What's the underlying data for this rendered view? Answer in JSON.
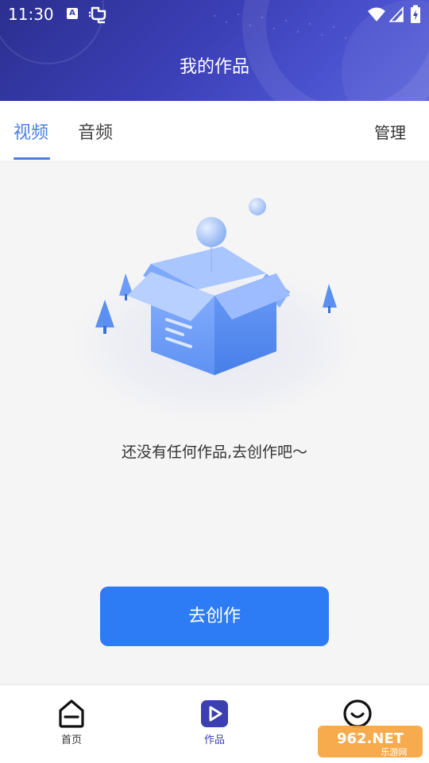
{
  "status_bar": {
    "time": "11:30",
    "a_badge": "A"
  },
  "header": {
    "title": "我的作品"
  },
  "tabs": {
    "items": [
      {
        "label": "视频",
        "active": true
      },
      {
        "label": "音频",
        "active": false
      }
    ],
    "manage_label": "管理"
  },
  "empty_state": {
    "message": "还没有任何作品,去创作吧～"
  },
  "actions": {
    "create_label": "去创作"
  },
  "bottom_nav": {
    "items": [
      {
        "label": "首页",
        "icon": "home-icon",
        "active": false
      },
      {
        "label": "作品",
        "icon": "play-icon",
        "active": true
      },
      {
        "label": "",
        "icon": "smile-icon",
        "active": false
      }
    ]
  },
  "watermark": {
    "text": "962.NET",
    "subtext": "乐游网"
  },
  "colors": {
    "header_start": "#2b2f8f",
    "header_end": "#5a63d8",
    "accent_tab": "#4c7ee6",
    "primary_button": "#2d7bf5",
    "active_nav": "#3b3fb0"
  }
}
